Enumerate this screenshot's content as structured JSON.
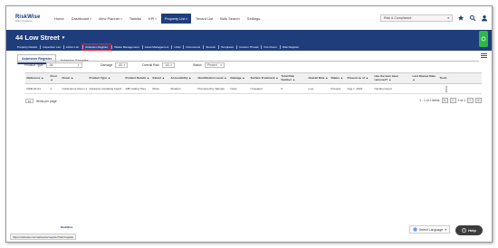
{
  "nav": {
    "logo": "RiskWise",
    "logo_sub": "Risk Compliance",
    "items": [
      {
        "label": "Home",
        "caret": ""
      },
      {
        "label": "Dashboard",
        "caret": "▾"
      },
      {
        "label": "View Planner",
        "caret": "▾"
      },
      {
        "label": "Tasklist",
        "caret": ""
      },
      {
        "label": "KPI",
        "caret": "▾"
      },
      {
        "label": "Property List",
        "caret": "▾"
      },
      {
        "label": "Tenant List",
        "caret": ""
      },
      {
        "label": "Bulk Search",
        "caret": ""
      },
      {
        "label": "Settings",
        "caret": ""
      }
    ],
    "active_index": 5,
    "org_select": "Risk & Compliance",
    "org_caret": "▾"
  },
  "property": {
    "title": "44 Low Street",
    "title_caret": "▾",
    "subtabs": [
      "Property Details",
      "Inspection List",
      "Action List",
      "Asbestos Register",
      "Waste Management",
      "Asset Management",
      "Units",
      "Documents",
      "Tenants",
      "Templates",
      "Custom Thread",
      "Fire Doors",
      "Risk Register"
    ],
    "active_subtab": 3
  },
  "content_tabs": [
    "Asbestos Register",
    "Asbestos Samples"
  ],
  "filters": {
    "product_type": {
      "label": "Product Type",
      "value": "-All-"
    },
    "damage": {
      "label": "Damage",
      "value": "-All-"
    },
    "overall_risk": {
      "label": "Overall Risk",
      "value": "-All-"
    },
    "status": {
      "label": "Status",
      "value": "Present"
    }
  },
  "table": {
    "columns": [
      "Reference ▲",
      "Floor ▲",
      "Room ▲",
      "Product Type ▲",
      "Product Details ▲",
      "Extent ▲",
      "Accessibility ▲",
      "Identification Level ▲",
      "Damage ▲",
      "Surface Treatment ▲",
      "Total Risk Number ▲",
      "Overall Risk ▲",
      "Status ▲",
      "Present as of ▲",
      "Has the item been removed? ▲",
      "Last Review Date ▲",
      "Tools"
    ],
    "rows": [
      [
        "R&R-01-01",
        "2",
        "Conference Room 1",
        "Asbestos insulating board",
        "AIB Ceiling Tiles",
        "Minor",
        "Medium",
        "Presumed by Sample",
        "None",
        "Unsealed",
        "5",
        "Low",
        "Present",
        "Aug 7, 2022",
        "Not Removed",
        "",
        ""
      ]
    ]
  },
  "pager": {
    "per_page_value": "10",
    "per_page_label": "Items per page",
    "summary": "1 - 1 of 1 items",
    "page_info": "1 of 1"
  },
  "footer": {
    "status_url": "https://riskwise.com/asbestos/register?tab=register",
    "logo": "RiskWise",
    "language": "Select Language",
    "help": "Help"
  },
  "colors": {
    "brand_navy": "#1f3d7a",
    "active_outline": "#e0202a",
    "green_badge": "#2db84a"
  }
}
